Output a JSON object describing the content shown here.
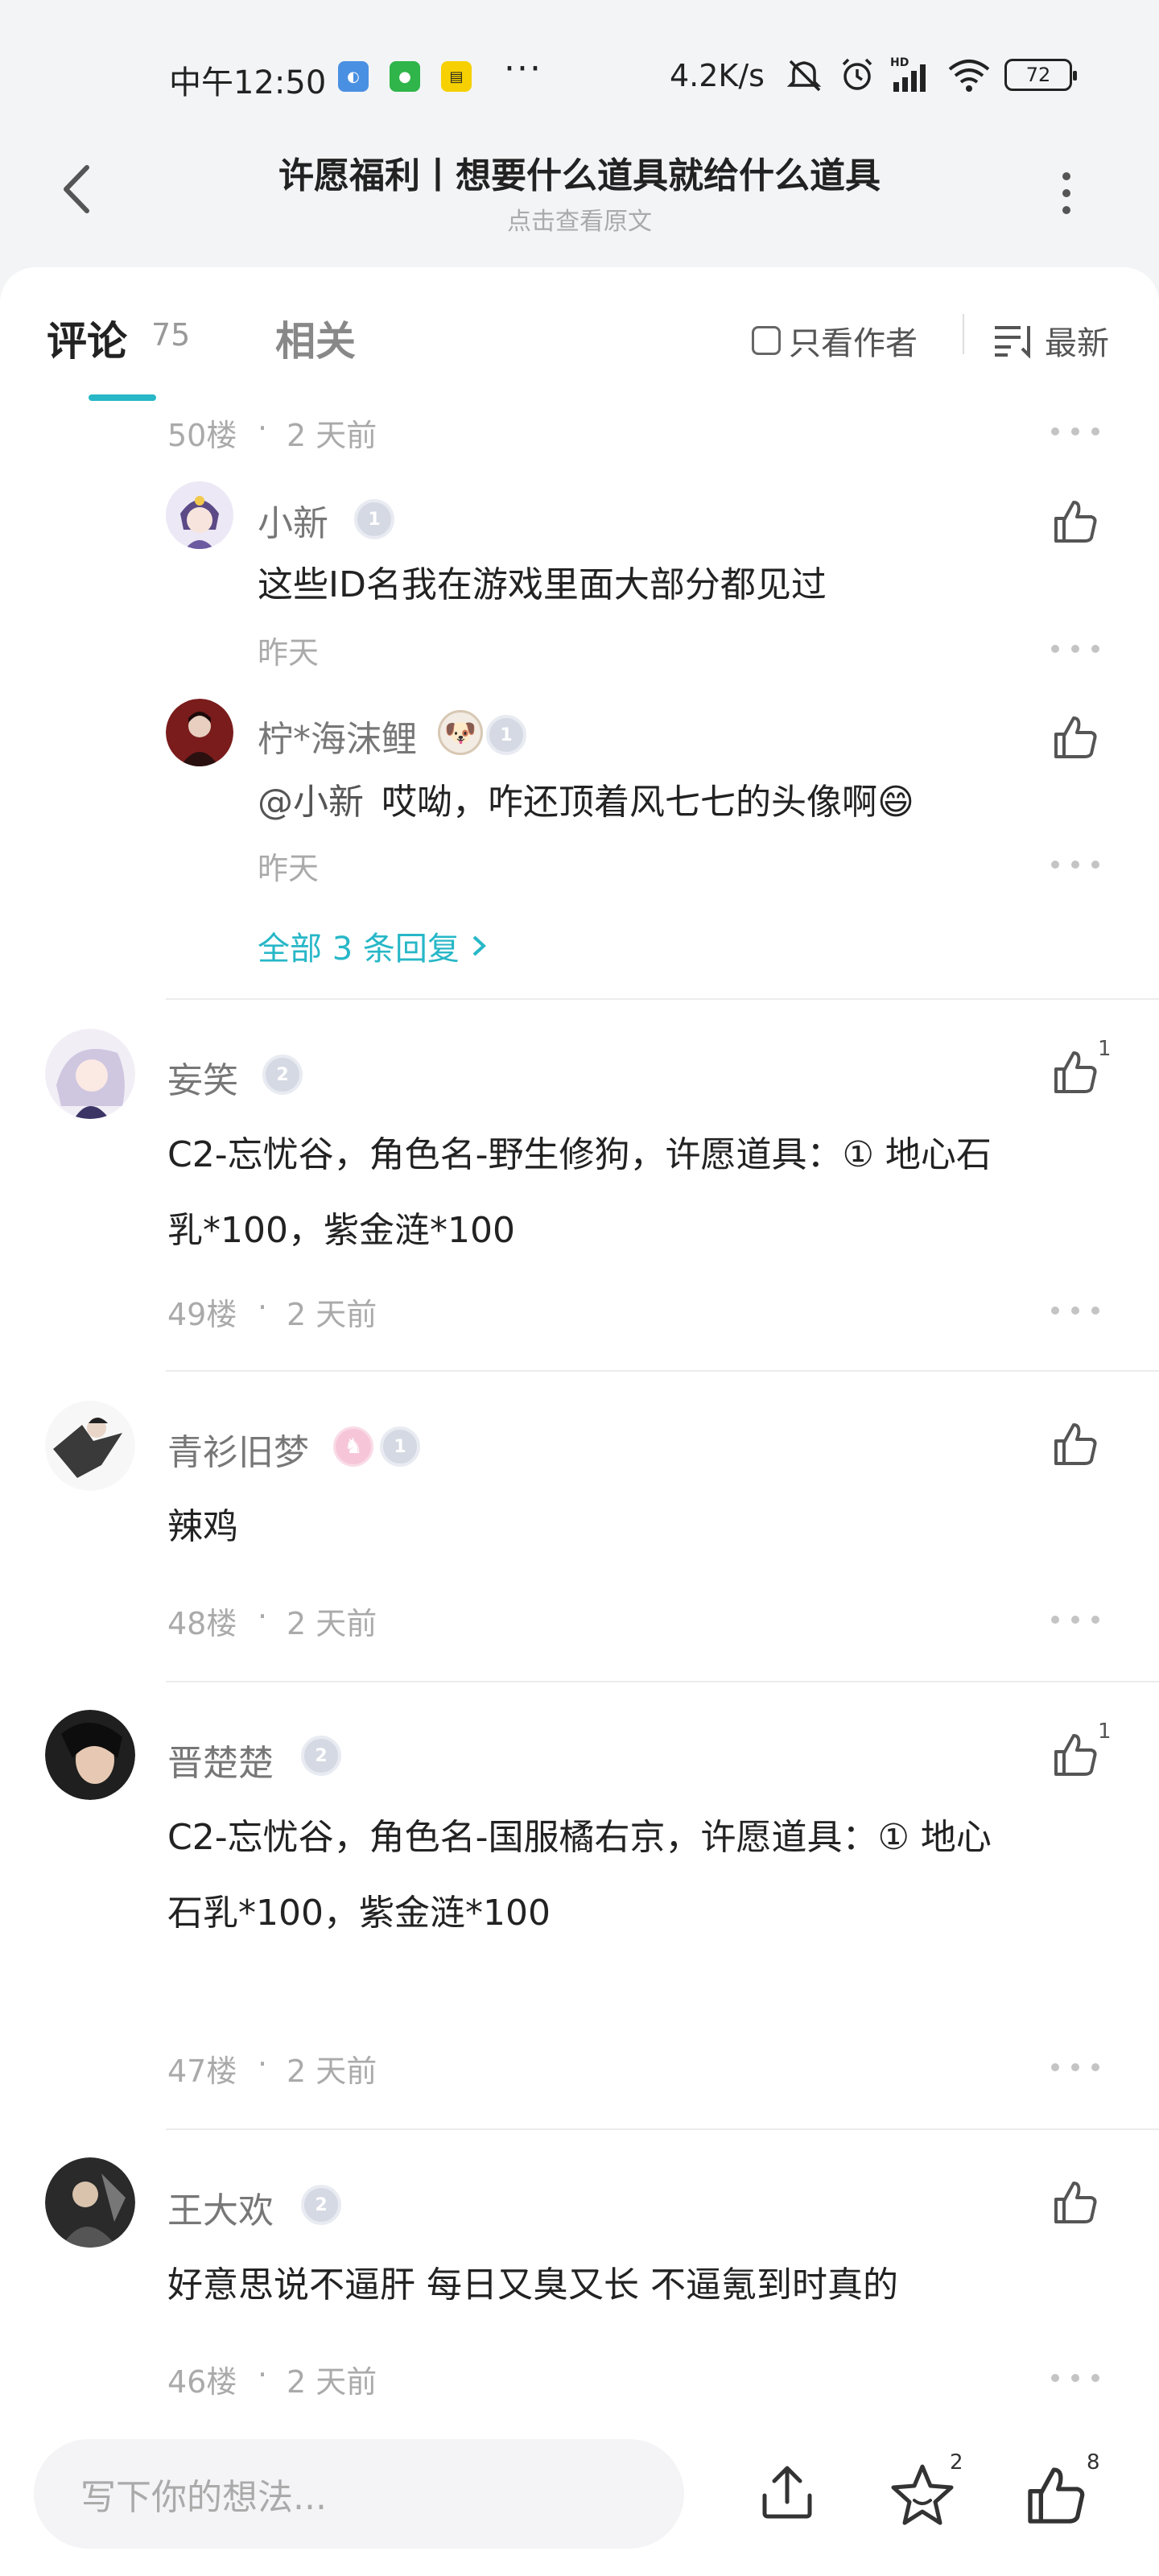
{
  "status_bar": {
    "time": "中午12:50",
    "more": "···",
    "speed": "4.2K/s",
    "battery": "72",
    "app_icons": [
      "qq-browser-icon",
      "wechat-icon",
      "news-icon"
    ]
  },
  "header": {
    "title": "许愿福利丨想要什么道具就给什么道具",
    "subtitle": "点击查看原文"
  },
  "tabs": {
    "comments_label": "评论",
    "comments_count": "75",
    "related_label": "相关",
    "author_only": "只看作者",
    "sort_label": "最新"
  },
  "thread": {
    "floor": "50楼",
    "sep": "·",
    "time": "2 天前",
    "replies": [
      {
        "name": "小新",
        "level": "1",
        "content": "这些ID名我在游戏里面大部分都见过",
        "time": "昨天"
      },
      {
        "name": "柠*海沫鲤",
        "level": "1",
        "mention": "@小新",
        "content": "哎呦，咋还顶着风七七的头像啊",
        "emoji": "😄",
        "time": "昨天"
      }
    ],
    "view_all": "全部 3 条回复"
  },
  "comments": [
    {
      "name": "妄笑",
      "level": "2",
      "like_count": "1",
      "content_lines": [
        "C2-忘忧谷，角色名-野生修狗，许愿道具：① 地心石",
        "乳*100，紫金涟*100"
      ],
      "floor": "49楼",
      "time": "2 天前"
    },
    {
      "name": "青衫旧梦",
      "level": "1",
      "like_count": "",
      "content_lines": [
        "辣鸡"
      ],
      "floor": "48楼",
      "time": "2 天前"
    },
    {
      "name": "晋楚楚",
      "level": "2",
      "like_count": "1",
      "content_lines": [
        "C2-忘忧谷，角色名-国服橘右京，许愿道具：① 地心",
        "石乳*100，紫金涟*100"
      ],
      "floor": "47楼",
      "time": "2 天前"
    },
    {
      "name": "王大欢",
      "level": "2",
      "like_count": "",
      "content_lines": [
        "好意思说不逼肝 每日又臭又长 不逼氪到时真的"
      ],
      "floor": "46楼",
      "time": "2 天前"
    }
  ],
  "bottom_bar": {
    "placeholder": "写下你的想法...",
    "favorite_count": "2",
    "like_count": "8"
  },
  "colors": {
    "accent": "#27b7c7",
    "background": "#f3f4f6",
    "card": "#ffffff"
  }
}
